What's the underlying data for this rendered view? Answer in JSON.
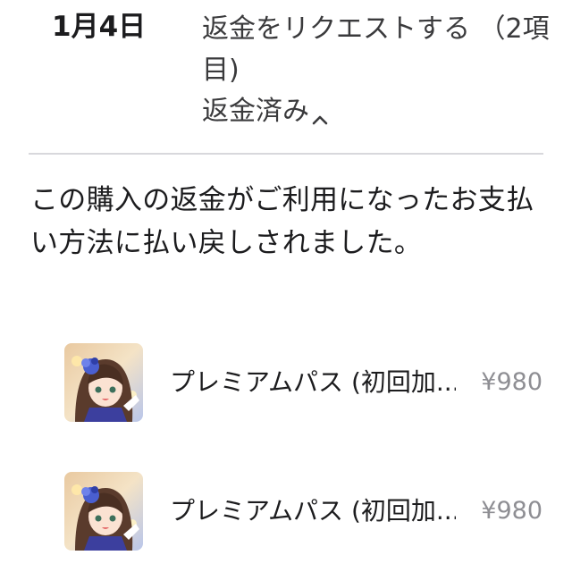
{
  "header": {
    "date": "1月4日",
    "title": "返金をリクエストする （2項目)",
    "status": "返金済み"
  },
  "note": "この購入の返金がご利用になったお支払い方法に払い戻しされました。",
  "items": [
    {
      "name": "プレミアムパス (初回加...",
      "price": "¥980",
      "thumbnail_icon": "character-portrait-icon"
    },
    {
      "name": "プレミアムパス (初回加...",
      "price": "¥980",
      "thumbnail_icon": "character-portrait-icon"
    }
  ],
  "colors": {
    "text_primary": "#1c1c1e",
    "text_secondary": "#3a3a3c",
    "price_gray": "#8e8e93",
    "divider": "#d8d8dc"
  }
}
